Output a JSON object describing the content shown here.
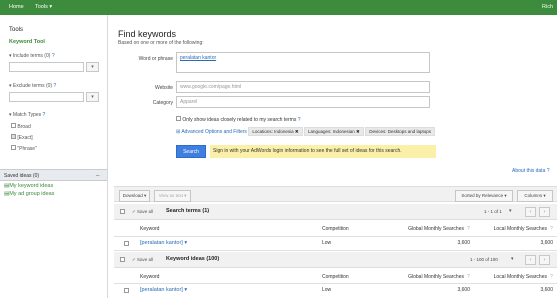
{
  "topbar": {
    "home": "Home",
    "tools": "Tools ▾",
    "user": "Rich"
  },
  "sidebar": {
    "tools_title": "Tools",
    "keyword_tool": "Keyword Tool",
    "include_terms": "▾ Include terms (0)",
    "exclude_terms": "▾ Exclude terms (0)",
    "match_types": "▾ Match Types",
    "broad": "Broad",
    "exact": "[Exact]",
    "phrase": "\"Phrase\"",
    "saved_ideas": "Saved ideas (0)",
    "my_keyword_ideas": "My keyword ideas",
    "my_ad_group_ideas": "My ad group ideas",
    "drop": "▾",
    "help": "?",
    "collapse": "_"
  },
  "main": {
    "title": "Find keywords",
    "subtitle": "Based on one or more of the following:",
    "word_label": "Word or phrase",
    "word_value": "peralatan kantor",
    "website_label": "Website",
    "website_placeholder": "www.google.com/page.html",
    "category_label": "Category",
    "category_placeholder": "Apparel",
    "closely_related": "Only show ideas closely related to my search terms",
    "help": "?",
    "advanced": "Advanced Options and Filters",
    "locations": "Locations: Indonesia ✖",
    "languages": "Languages: Indonesian ✖",
    "devices": "Devices: Desktops and laptops",
    "search_btn": "Search",
    "sign_in_text": "Sign in with your AdWords login information to see the full set of ideas for this search.",
    "about_data": "About this data ?"
  },
  "toolbar": {
    "download": "Download ▾",
    "view_as_text": "View as text ▾",
    "sorted_by": "Sorted by Relevance ▾",
    "columns": "Columns ▾"
  },
  "search_terms": {
    "save_all": "✓ Save all",
    "title": "Search terms (1)",
    "pager": "1 - 1 of 1",
    "headers": [
      "Keyword",
      "Competition",
      "Global Monthly Searches",
      "Local Monthly Searches"
    ],
    "rows": [
      {
        "keyword": "[peralatan kantor] ▾",
        "competition": "Low",
        "global": "3,600",
        "local": "3,600"
      }
    ]
  },
  "keyword_ideas": {
    "save_all": "✓ Save all",
    "title": "Keyword ideas (100)",
    "pager": "1 - 100 of 100",
    "headers": [
      "Keyword",
      "Competition",
      "Global Monthly Searches",
      "Local Monthly Searches"
    ],
    "rows": [
      {
        "keyword": "[peralatan kantor] ▾",
        "competition": "Low",
        "global": "3,600",
        "local": "3,600"
      }
    ]
  },
  "glyphs": {
    "prev": "‹",
    "next": "›",
    "help": "?",
    "dropdown": "▾",
    "info": "⊞",
    "save": "✓"
  },
  "colors": {
    "topbar": "#3d8c3d",
    "search_button": "#3f7fe0",
    "message_bg": "#faf0a8",
    "link": "#2a6bb5"
  }
}
